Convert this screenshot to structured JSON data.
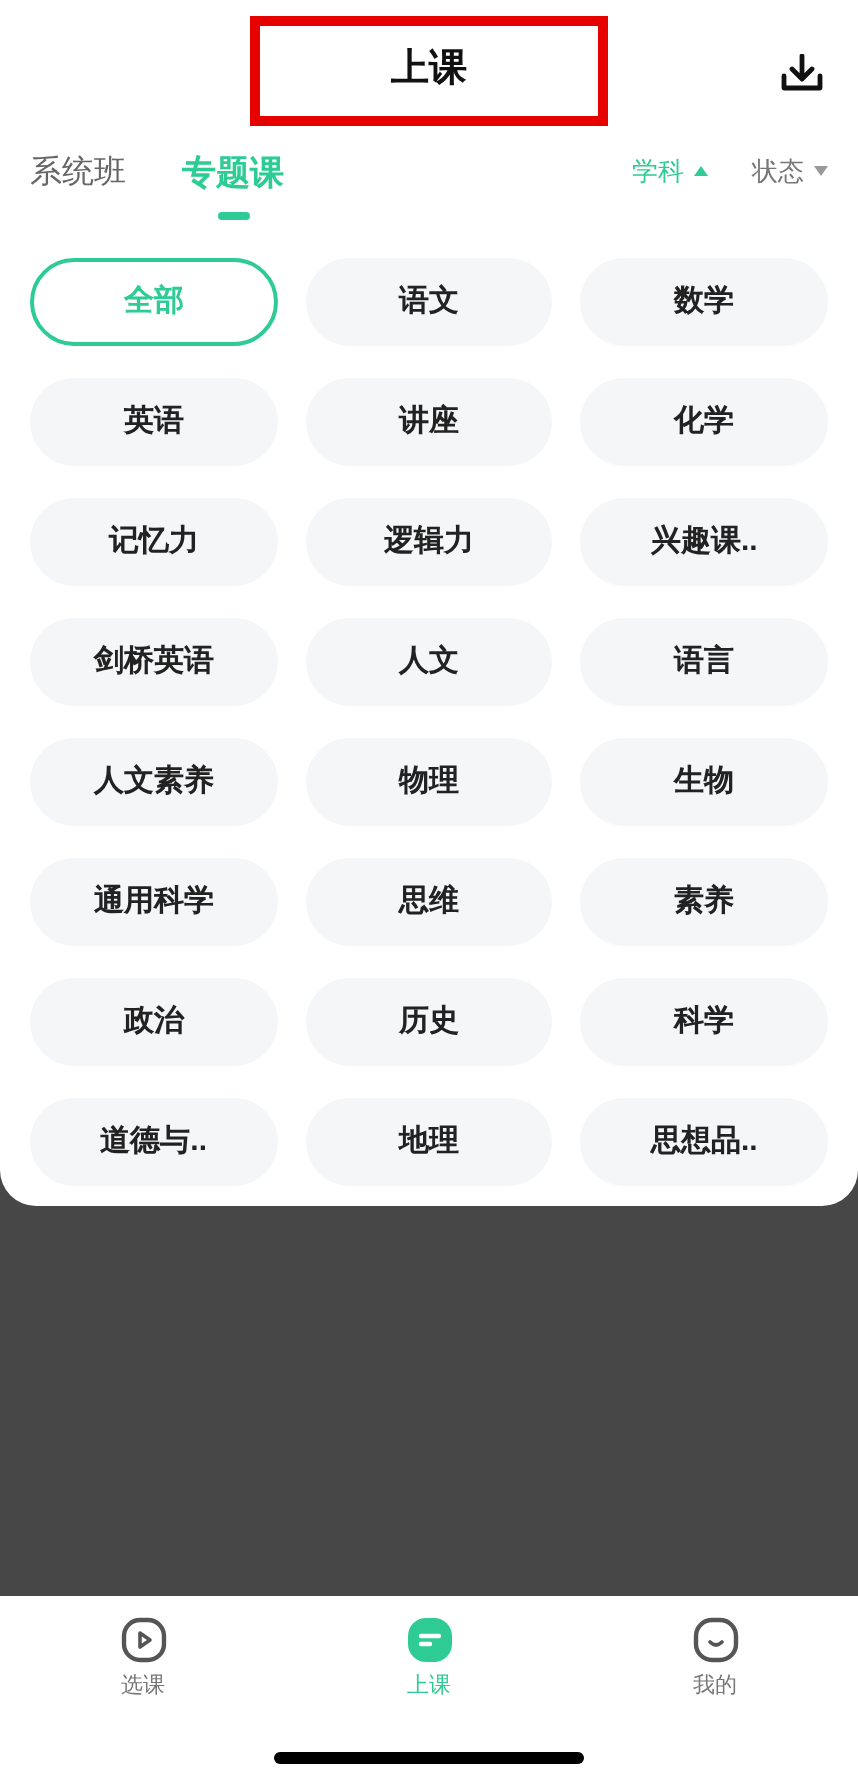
{
  "header": {
    "title": "上课",
    "highlighted": true
  },
  "tabs": [
    {
      "label": "系统班",
      "selected": false
    },
    {
      "label": "专题课",
      "selected": true
    }
  ],
  "filters": [
    {
      "label": "学科",
      "active": true
    },
    {
      "label": "状态",
      "active": false
    }
  ],
  "subjects": [
    {
      "label": "全部",
      "selected": true
    },
    {
      "label": "语文",
      "selected": false
    },
    {
      "label": "数学",
      "selected": false
    },
    {
      "label": "英语",
      "selected": false
    },
    {
      "label": "讲座",
      "selected": false
    },
    {
      "label": "化学",
      "selected": false
    },
    {
      "label": "记忆力",
      "selected": false
    },
    {
      "label": "逻辑力",
      "selected": false
    },
    {
      "label": "兴趣课..",
      "selected": false
    },
    {
      "label": "剑桥英语",
      "selected": false
    },
    {
      "label": "人文",
      "selected": false
    },
    {
      "label": "语言",
      "selected": false
    },
    {
      "label": "人文素养",
      "selected": false
    },
    {
      "label": "物理",
      "selected": false
    },
    {
      "label": "生物",
      "selected": false
    },
    {
      "label": "通用科学",
      "selected": false
    },
    {
      "label": "思维",
      "selected": false
    },
    {
      "label": "素养",
      "selected": false
    },
    {
      "label": "政治",
      "selected": false
    },
    {
      "label": "历史",
      "selected": false
    },
    {
      "label": "科学",
      "selected": false
    },
    {
      "label": "道德与..",
      "selected": false
    },
    {
      "label": "地理",
      "selected": false
    },
    {
      "label": "思想品..",
      "selected": false
    }
  ],
  "bottom_nav": [
    {
      "label": "选课",
      "kind": "play",
      "selected": false
    },
    {
      "label": "上课",
      "kind": "class",
      "selected": true
    },
    {
      "label": "我的",
      "kind": "face",
      "selected": false
    }
  ]
}
